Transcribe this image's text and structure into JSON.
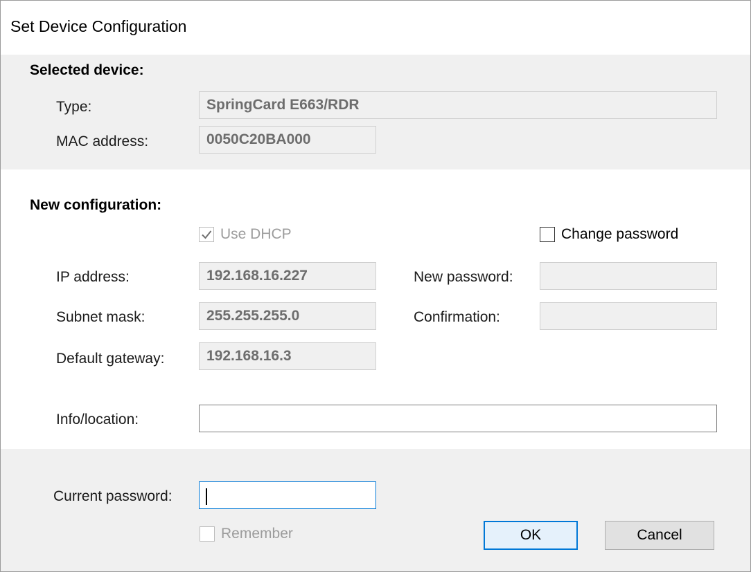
{
  "window": {
    "title": "Set Device Configuration"
  },
  "selected_device": {
    "heading": "Selected device:",
    "type_label": "Type:",
    "type_value": "SpringCard E663/RDR",
    "mac_label": "MAC address:",
    "mac_value": "0050C20BA000"
  },
  "new_configuration": {
    "heading": "New configuration:",
    "use_dhcp": {
      "label": "Use DHCP",
      "checked": true,
      "enabled": false
    },
    "change_password": {
      "label": "Change password",
      "checked": false,
      "enabled": true
    },
    "ip_label": "IP address:",
    "ip_value": "192.168.16.227",
    "subnet_label": "Subnet mask:",
    "subnet_value": "255.255.255.0",
    "gateway_label": "Default gateway:",
    "gateway_value": "192.168.16.3",
    "new_password_label": "New password:",
    "new_password_value": "",
    "confirmation_label": "Confirmation:",
    "confirmation_value": "",
    "info_label": "Info/location:",
    "info_value": ""
  },
  "footer": {
    "current_password_label": "Current password:",
    "current_password_value": "",
    "remember": {
      "label": "Remember",
      "checked": false,
      "enabled": false
    },
    "ok_label": "OK",
    "cancel_label": "Cancel"
  },
  "colors": {
    "accent": "#0078d7",
    "panel": "#f0f0f0",
    "disabled_text": "#6d6d6d"
  }
}
